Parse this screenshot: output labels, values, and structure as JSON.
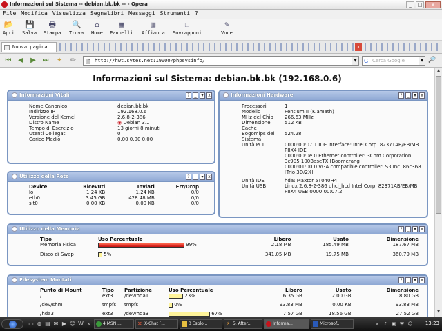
{
  "window": {
    "title": "Informazioni sul Sistema -- debian.bk.bk -- - Opera"
  },
  "menu": [
    "File",
    "Modifica",
    "Visualizza",
    "Segnalibri",
    "Messaggi",
    "Strumenti",
    "?"
  ],
  "toolbar": [
    {
      "label": "Apri",
      "icon": "folder-icon"
    },
    {
      "label": "Salva",
      "icon": "floppy-icon"
    },
    {
      "label": "Stampa",
      "icon": "printer-icon"
    },
    {
      "label": "Trova",
      "icon": "magnifier-icon"
    },
    {
      "label": "Home",
      "icon": "home-icon"
    },
    {
      "label": "Pannelli",
      "icon": "panels-icon"
    },
    {
      "label": "Affianca",
      "icon": "tile-icon"
    },
    {
      "label": "Sovrapponi",
      "icon": "cascade-icon"
    },
    {
      "label": "Voce",
      "icon": "voice-icon"
    }
  ],
  "tab": {
    "label": "Nuova pagina"
  },
  "address": {
    "url": "http://hwt.sytes.net:19000/phpsysinfo/",
    "search_placeholder": "Cerca Google"
  },
  "page": {
    "title": "Informazioni sul Sistema: debian.bk.bk (192.168.0.6)"
  },
  "vitals": {
    "title": "Informazioni Vitali",
    "rows": [
      [
        "Nome Canonico",
        "debian.bk.bk"
      ],
      [
        "Indirizzo IP",
        "192.168.0.6"
      ],
      [
        "Versione del Kernel",
        "2.6.8-2-386"
      ],
      [
        "Distro Name",
        "Debian 3.1"
      ],
      [
        "Tempo di Esercizio",
        "13 giorni 8 minuti"
      ],
      [
        "Utenti Collegati",
        "0"
      ],
      [
        "Carico Medio",
        "0.00 0.00 0.00"
      ]
    ]
  },
  "hardware": {
    "title": "Informazioni Hardware",
    "rows": [
      [
        "Processori",
        "1"
      ],
      [
        "Modello",
        "Pentium II (Klamath)"
      ],
      [
        "MHz del Chip",
        "266.63 MHz"
      ],
      [
        "Dimensione Cache",
        "512 KB"
      ],
      [
        "Bogomips del Sistema",
        "524.28"
      ],
      [
        "Unità PCI",
        "0000:00:07.1 IDE interface: Intel Corp. 82371AB/EB/MB PIIX4 IDE\n0000:00:0e.0 Ethernet controller: 3Com Corporation 3c905 100BaseTX [Boomerang]\n0000:01:00.0 VGA compatible controller: S3 Inc. 86c368 [Trio 3D/2X]"
      ],
      [
        "Unità IDE",
        "hda: Maxtor 5T040H4"
      ],
      [
        "Unità USB",
        "Linux 2.6.8-2-386 uhci_hcd Intel Corp. 82371AB/EB/MB PIIX4 USB 0000:00:07.2"
      ]
    ]
  },
  "network": {
    "title": "Utilizzo della Rete",
    "headers": [
      "Device",
      "Ricevuti",
      "Inviati",
      "Err/Drop"
    ],
    "rows": [
      [
        "lo",
        "1.24 KB",
        "1.24 KB",
        "0/0"
      ],
      [
        "eth0",
        "3.45 GB",
        "428.48 MB",
        "0/0"
      ],
      [
        "sit0",
        "0.00 KB",
        "0.00 KB",
        "0/0"
      ]
    ]
  },
  "memory": {
    "title": "Utilizzo della Memoria",
    "headers": [
      "Tipo",
      "Uso Percentuale",
      "Libero",
      "Usato",
      "Dimensione"
    ],
    "rows": [
      {
        "type": "Memoria Fisica",
        "percent": 99,
        "percent_label": "99%",
        "free": "2.18 MB",
        "used": "185.49 MB",
        "size": "187.67 MB",
        "color": "#e02a18"
      },
      {
        "type": "Disco di Swap",
        "percent": 5,
        "percent_label": "5%",
        "free": "341.05 MB",
        "used": "19.75 MB",
        "size": "360.79 MB",
        "color": "#fff49a"
      }
    ]
  },
  "filesystems": {
    "title": "Filesystem Montati",
    "headers": [
      "Punto di Mount",
      "Tipo",
      "Partizione",
      "Uso Percentuale",
      "Libero",
      "Usato",
      "Dimensione"
    ],
    "rows": [
      {
        "mount": "/",
        "type": "ext3",
        "part": "/dev/hda1",
        "percent": 23,
        "percent_label": "23%",
        "free": "6.35 GB",
        "used": "2.00 GB",
        "size": "8.80 GB"
      },
      {
        "mount": "/dev/shm",
        "type": "tmpfs",
        "part": "tmpfs",
        "percent": 0,
        "percent_label": "0%",
        "free": "93.83 MB",
        "used": "0.00 KB",
        "size": "93.83 MB"
      },
      {
        "mount": "/hda3",
        "type": "ext3",
        "part": "/dev/hda3",
        "percent": 67,
        "percent_label": "67%",
        "free": "7.57 GB",
        "used": "18.56 GB",
        "size": "27.52 GB"
      }
    ]
  },
  "taskbar": {
    "tasks": [
      {
        "label": "4 MSN ...",
        "icon": "msn-icon",
        "active": false
      },
      {
        "label": "X-Chat [...",
        "icon": "xchat-icon",
        "active": false
      },
      {
        "label": "3 Esplo...",
        "icon": "explorer-icon",
        "active": false
      },
      {
        "label": "5. After...",
        "icon": "winamp-icon",
        "active": false
      },
      {
        "label": "Informa...",
        "icon": "opera-icon",
        "active": true
      },
      {
        "label": "Microsof...",
        "icon": "word-icon",
        "active": false
      }
    ],
    "clock": "13:23"
  },
  "colors": {
    "box_border": "#7a96c2",
    "box_header": "#8ea8d4",
    "memory_bar": "#e02a18",
    "swap_bar": "#fff49a"
  }
}
